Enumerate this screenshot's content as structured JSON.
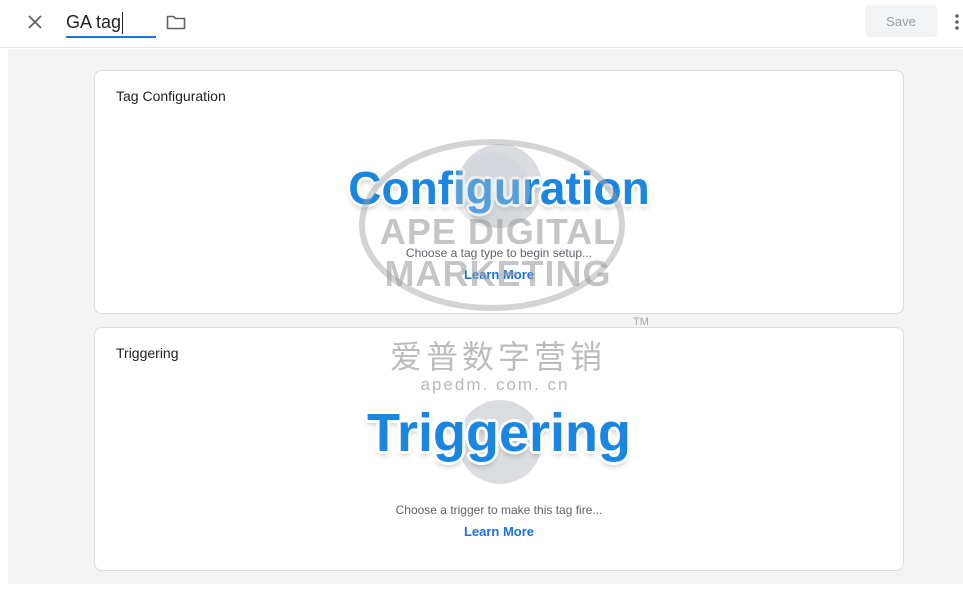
{
  "topbar": {
    "close_icon": "close-icon",
    "tag_name_value": "GA tag",
    "folder_icon": "folder-icon",
    "save_label": "Save",
    "more_icon": "more-vert-icon"
  },
  "config_panel": {
    "title": "Tag Configuration",
    "overlay_label": "Configuration",
    "hint": "Choose a tag type to begin setup...",
    "link": "Learn More"
  },
  "trigger_panel": {
    "title": "Triggering",
    "overlay_label": "Triggering",
    "hint": "Choose a trigger to make this tag fire...",
    "link": "Learn More"
  },
  "watermark": {
    "brand": "APE DIGITAL MARKETING",
    "tm": "TM",
    "chinese": "爱普数字营销",
    "url": "apedm. com. cn"
  },
  "colors": {
    "accent": "#1a73e8",
    "overlay_blue": "#1a86e0",
    "background": "#f3f3f3"
  }
}
